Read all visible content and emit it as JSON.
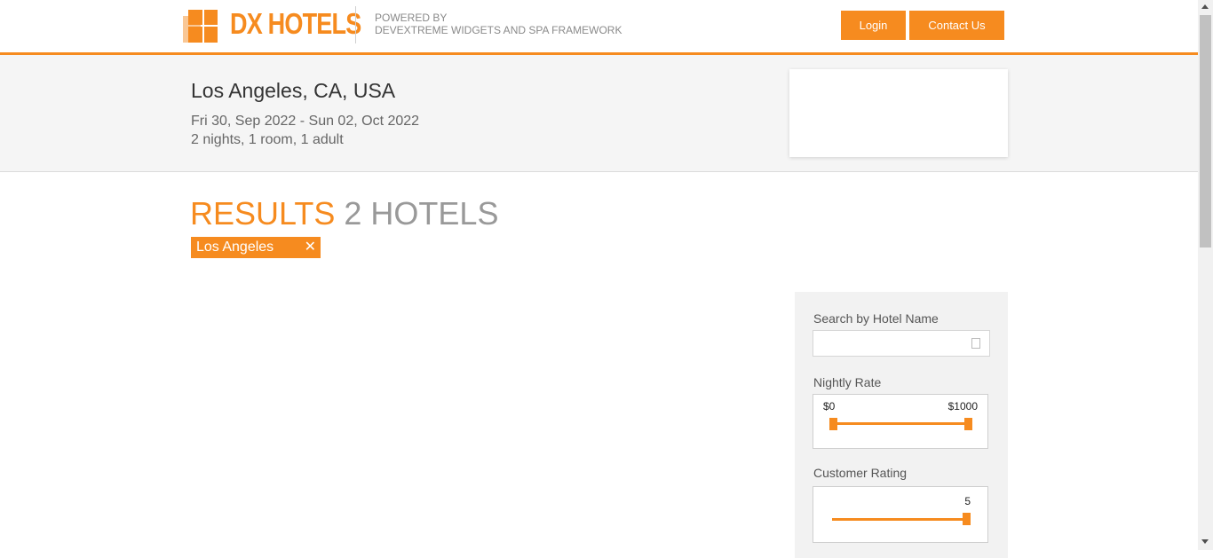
{
  "header": {
    "brand": "DX HOTELS",
    "powered_line1": "POWERED BY",
    "powered_line2": "DEVEXTREME WIDGETS AND SPA FRAMEWORK",
    "login_label": "Login",
    "contact_label": "Contact Us"
  },
  "search_summary": {
    "city": "Los Angeles, CA, USA",
    "dates": "Fri 30, Sep 2022 - Sun 02, Oct 2022",
    "stay": "2 nights, 1 room, 1 adult"
  },
  "results": {
    "title_word": "RESULTS",
    "count_text": "2 HOTELS",
    "tag_label": "Los Angeles",
    "tag_close": "✕"
  },
  "filters": {
    "search_label": "Search by Hotel Name",
    "search_value": "",
    "rate_label": "Nightly Rate",
    "rate_min": "$0",
    "rate_max": "$1000",
    "rating_label": "Customer Rating",
    "rating_value": "5"
  },
  "colors": {
    "accent": "#f68b1f",
    "muted": "#999999"
  }
}
